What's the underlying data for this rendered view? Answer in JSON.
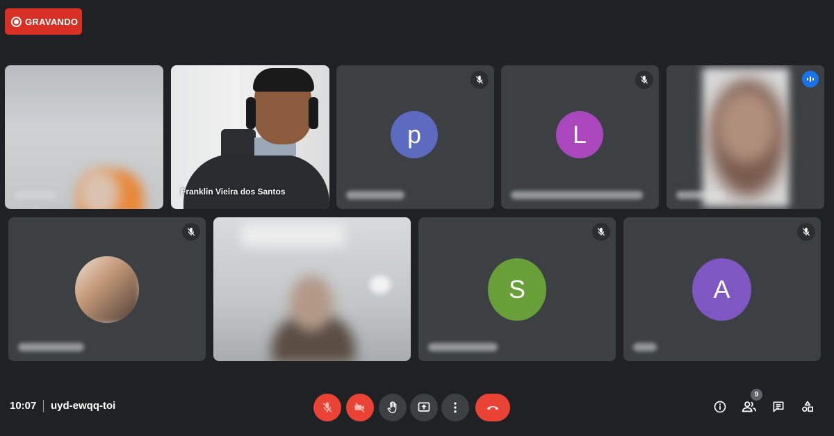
{
  "recording": {
    "label": "GRAVANDO"
  },
  "tiles": [
    {
      "kind": "video",
      "name": "",
      "blurred": true
    },
    {
      "kind": "video",
      "name": "Franklin Vieira dos Santos",
      "blurred": false
    },
    {
      "kind": "avatar",
      "initial": "p",
      "color": "#5c6bc0",
      "muted": true,
      "name_blurred": true
    },
    {
      "kind": "avatar",
      "initial": "L",
      "color": "#ab47bc",
      "muted": true,
      "name_blurred": true
    },
    {
      "kind": "video",
      "name": "",
      "blurred": true,
      "speaking": true
    },
    {
      "kind": "photo-avatar",
      "muted": true,
      "name_blurred": true
    },
    {
      "kind": "video",
      "name": "",
      "blurred": true
    },
    {
      "kind": "avatar",
      "initial": "S",
      "color": "#689f38",
      "muted": true,
      "name_blurred": true
    },
    {
      "kind": "avatar",
      "initial": "A",
      "color": "#7e57c2",
      "muted": true,
      "name_blurred": true
    }
  ],
  "bottom_bar": {
    "time": "10:07",
    "meeting_code": "uyd-ewqq-toi",
    "participants_count": "9"
  },
  "icons": {
    "mic": "mic-off-icon",
    "camera": "camera-off-icon",
    "hand": "raise-hand-icon",
    "present": "present-screen-icon",
    "more": "more-vert-icon",
    "end": "end-call-icon",
    "info": "info-icon",
    "people": "people-icon",
    "chat": "chat-icon",
    "activities": "activities-icon"
  },
  "colors": {
    "background": "#202124",
    "tile": "#3c4043",
    "danger": "#ea4335",
    "speaking": "#8ab4f8"
  }
}
